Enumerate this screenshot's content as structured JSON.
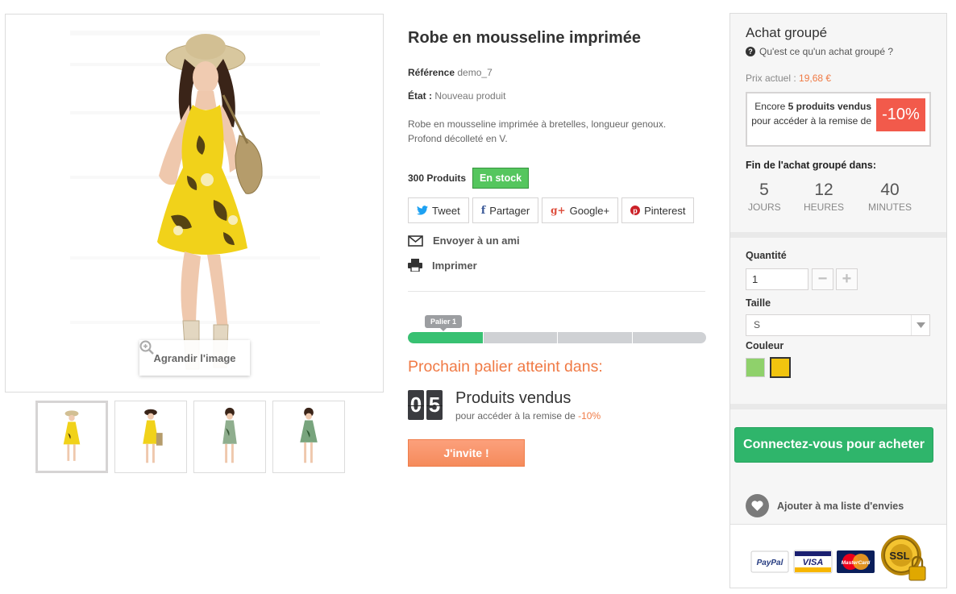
{
  "product": {
    "title": "Robe en mousseline imprimée",
    "reference_label": "Référence",
    "reference_value": "demo_7",
    "condition_label": "État :",
    "condition_value": "Nouveau produit",
    "description": "Robe en mousseline imprimée à bretelles, longueur genoux. Profond décolleté en V.",
    "quantity_text": "300 Produits",
    "stock_badge": "En stock",
    "zoom_label": "Agrandir l'image"
  },
  "social": {
    "tweet": "Tweet",
    "share": "Partager",
    "googleplus": "Google+",
    "pinterest": "Pinterest"
  },
  "links": {
    "send_friend": "Envoyer à un ami",
    "print": "Imprimer"
  },
  "group_progress": {
    "tier_label": "Palier 1",
    "fill_fraction": 0.25,
    "segments": 4,
    "next_tier_title": "Prochain palier atteint dans:",
    "counter_digits": [
      "0",
      "5"
    ],
    "sold_label": "Produits vendus",
    "discount_prefix": "pour accéder à la remise de",
    "discount_value": "-10%",
    "invite_button": "J'invite !"
  },
  "panel": {
    "title": "Achat groupé",
    "what_is_it": "Qu'est ce qu'un achat groupé ?",
    "current_price_label": "Prix actuel :",
    "current_price_value": "19,68 €",
    "discount_text_prefix": "Encore",
    "discount_text_strong": "5 produits vendus",
    "discount_text_suffix": "pour accéder à la remise de",
    "discount_badge": "-10%",
    "end_title": "Fin de l'achat groupé dans:",
    "countdown": [
      {
        "value": "5",
        "label": "JOURS"
      },
      {
        "value": "12",
        "label": "HEURES"
      },
      {
        "value": "40",
        "label": "MINUTES"
      }
    ],
    "quantity_label": "Quantité",
    "quantity_value": "1",
    "size_label": "Taille",
    "size_value": "S",
    "color_label": "Couleur",
    "colors": [
      "#8fd16b",
      "#f1c40f"
    ],
    "buy_button": "Connectez-vous pour acheter",
    "wishlist_label": "Ajouter à ma liste d'envies",
    "payment": [
      "PayPal",
      "VISA",
      "MasterCard",
      "SSL"
    ]
  },
  "colors": {
    "accent_orange": "#f07a45",
    "green": "#2fb56b",
    "stock_green": "#55c65e",
    "discount_red": "#f25a4b"
  }
}
